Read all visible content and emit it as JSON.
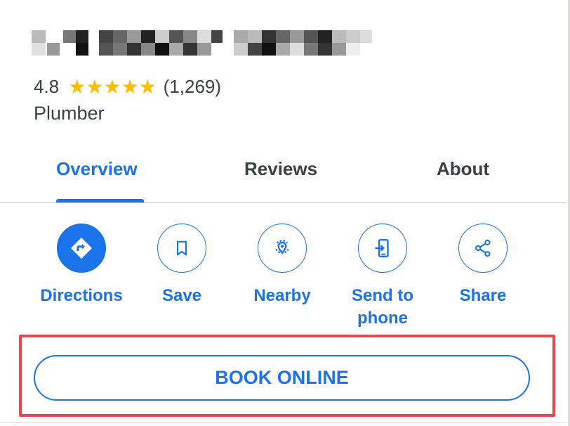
{
  "place": {
    "rating": "4.8",
    "stars": "★★★★★",
    "review_count": "(1,269)",
    "category": "Plumber"
  },
  "tabs": [
    {
      "label": "Overview",
      "active": true
    },
    {
      "label": "Reviews",
      "active": false
    },
    {
      "label": "About",
      "active": false
    }
  ],
  "actions": [
    {
      "label": "Directions",
      "icon": "directions-icon"
    },
    {
      "label": "Save",
      "icon": "bookmark-icon"
    },
    {
      "label": "Nearby",
      "icon": "nearby-icon"
    },
    {
      "label": "Send to phone",
      "icon": "send-to-phone-icon"
    },
    {
      "label": "Share",
      "icon": "share-icon"
    }
  ],
  "book_online": {
    "label": "BOOK ONLINE"
  },
  "colors": {
    "accent": "#1a73e8",
    "star": "#fbbc04",
    "highlight_frame": "#e5484d",
    "text": "#3c4043"
  }
}
